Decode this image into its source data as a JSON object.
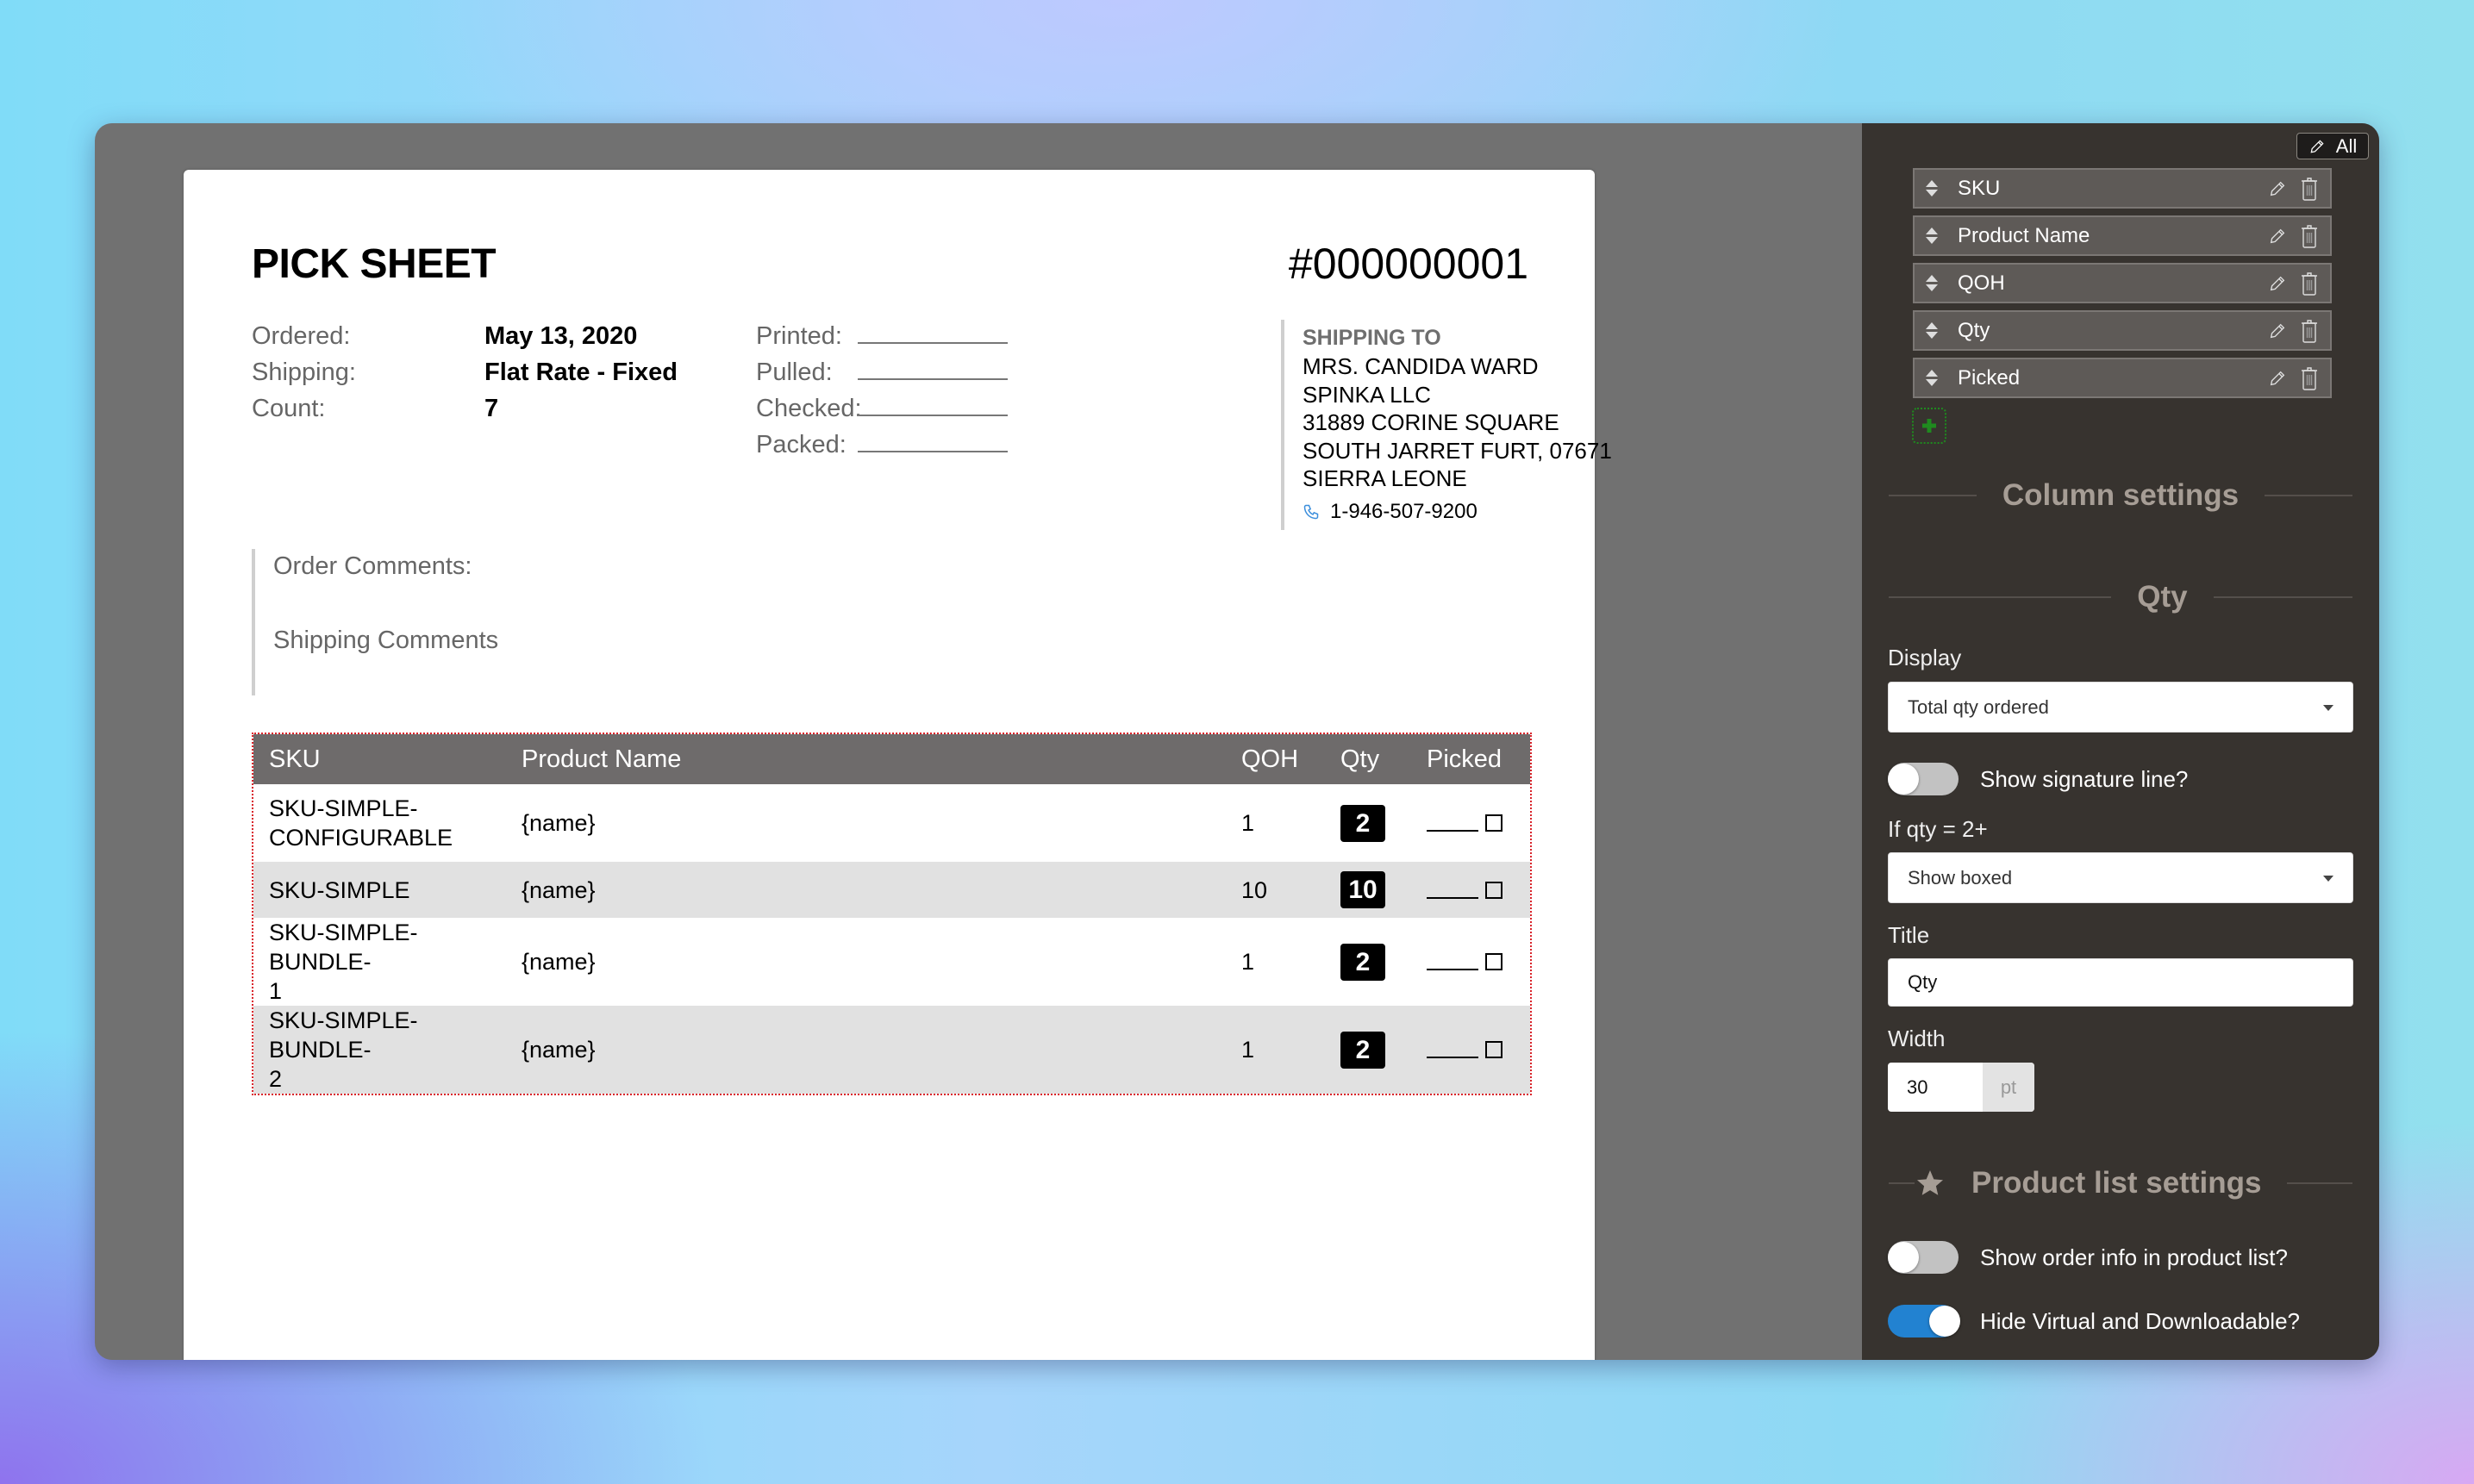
{
  "document": {
    "title": "PICK SHEET",
    "order_number": "#000000001",
    "meta": [
      {
        "label": "Ordered:",
        "value": "May 13, 2020"
      },
      {
        "label": "Shipping:",
        "value": "Flat Rate - Fixed"
      },
      {
        "label": "Count:",
        "value": "7"
      }
    ],
    "status_fields": [
      {
        "label": "Printed:"
      },
      {
        "label": "Pulled:"
      },
      {
        "label": "Checked:"
      },
      {
        "label": "Packed:"
      }
    ],
    "shipping_to": {
      "heading": "SHIPPING TO",
      "lines": [
        "MRS. CANDIDA WARD",
        "SPINKA LLC",
        "31889 CORINE SQUARE",
        "SOUTH JARRET FURT, 07671",
        "SIERRA LEONE"
      ],
      "phone": "1-946-507-9200",
      "phone_icon_color": "#3d8fdc"
    },
    "comments": {
      "order_label": "Order Comments:",
      "shipping_label": "Shipping Comments"
    },
    "table": {
      "columns": [
        "SKU",
        "Product Name",
        "QOH",
        "Qty",
        "Picked"
      ],
      "rows": [
        {
          "sku": "SKU-SIMPLE-CONFIGURABLE",
          "sku_display": [
            "SKU-SIMPLE-",
            "CONFIGURABLE"
          ],
          "name": "{name}",
          "qoh": "1",
          "qty": "2"
        },
        {
          "sku": "SKU-SIMPLE",
          "sku_display": [
            "SKU-SIMPLE"
          ],
          "name": "{name}",
          "qoh": "10",
          "qty": "10"
        },
        {
          "sku": "SKU-SIMPLE-BUNDLE-1",
          "sku_display": [
            "SKU-SIMPLE-BUNDLE-",
            "1"
          ],
          "name": "{name}",
          "qoh": "1",
          "qty": "2"
        },
        {
          "sku": "SKU-SIMPLE-BUNDLE-2",
          "sku_display": [
            "SKU-SIMPLE-BUNDLE-",
            "2"
          ],
          "name": "{name}",
          "qoh": "1",
          "qty": "2"
        }
      ],
      "header_bg": "#6e6b6b",
      "selection_outline_color": "#d9232a"
    }
  },
  "panel": {
    "edit_all_label": "All",
    "columns": [
      {
        "label": "SKU"
      },
      {
        "label": "Product Name"
      },
      {
        "label": "QOH"
      },
      {
        "label": "Qty"
      },
      {
        "label": "Picked"
      }
    ],
    "add_column_color": "#1f8a1f",
    "column_settings_heading": "Column settings",
    "selected_column_heading": "Qty",
    "display_label": "Display",
    "display_value": "Total qty ordered",
    "signature_toggle": {
      "label": "Show signature line?",
      "on": false
    },
    "if_qty_label": "If qty = 2+",
    "if_qty_value": "Show boxed",
    "title_label": "Title",
    "title_value": "Qty",
    "width_label": "Width",
    "width_value": "30",
    "width_unit": "pt",
    "product_list_heading": "Product list settings",
    "show_order_info_toggle": {
      "label": "Show order info in product list?",
      "on": false
    },
    "hide_virtual_toggle": {
      "label": "Hide Virtual and Downloadable?",
      "on": true
    },
    "accent_color": "#2282d1"
  }
}
